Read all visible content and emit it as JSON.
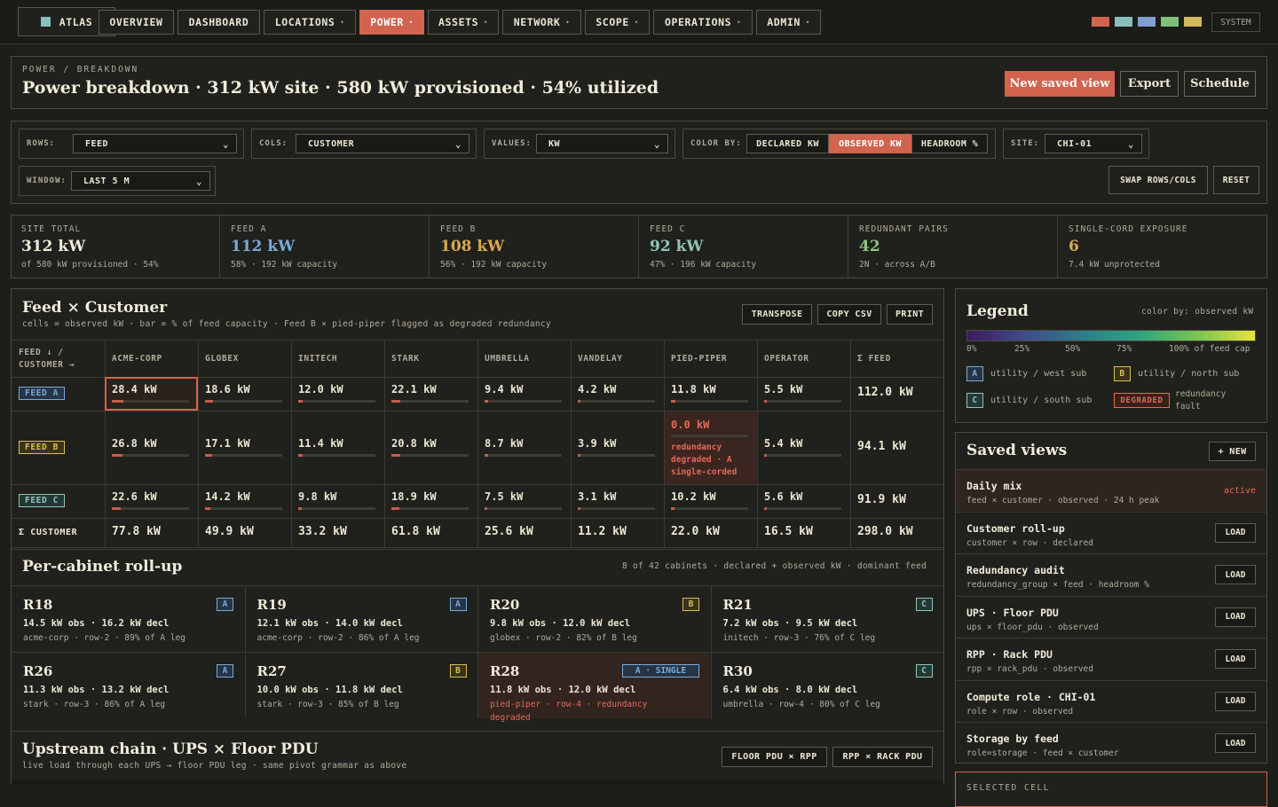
{
  "nav": {
    "logo": "ATLAS",
    "items": [
      {
        "label": "OVERVIEW",
        "caret": ""
      },
      {
        "label": "DASHBOARD",
        "caret": ""
      },
      {
        "label": "LOCATIONS",
        "caret": "▾"
      },
      {
        "label": "POWER",
        "caret": "▾"
      },
      {
        "label": "ASSETS",
        "caret": "▾"
      },
      {
        "label": "NETWORK",
        "caret": "▾"
      },
      {
        "label": "SCOPE",
        "caret": "▾"
      },
      {
        "label": "OPERATIONS",
        "caret": "▾"
      },
      {
        "label": "ADMIN",
        "caret": "▾"
      }
    ],
    "swatches": [
      "#d1634f",
      "#8bbfbd",
      "#7f9fd0",
      "#7fbf7a",
      "#d4b85c"
    ],
    "system": "SYSTEM"
  },
  "header": {
    "breadcrumb": "POWER / BREAKDOWN",
    "title": "Power breakdown · 312 kW site · 580 kW provisioned · 54% utilized",
    "buttons": {
      "new_view": "New saved view",
      "export": "Export",
      "schedule": "Schedule"
    }
  },
  "controls": {
    "rows_label": "ROWS:",
    "rows_value": "FEED",
    "cols_label": "COLS:",
    "cols_value": "CUSTOMER",
    "values_label": "VALUES:",
    "values_value": "KW",
    "color_label": "COLOR BY:",
    "color_options": [
      "DECLARED KW",
      "OBSERVED KW",
      "HEADROOM %"
    ],
    "color_selected": "OBSERVED KW",
    "site_label": "SITE:",
    "site_value": "CHI-01",
    "window_label": "WINDOW:",
    "window_value": "LAST 5 M",
    "swap": "SWAP ROWS/COLS",
    "reset": "RESET"
  },
  "kpis": [
    {
      "label": "SITE TOTAL",
      "value": "312 kW",
      "sub": "of 580 kW provisioned · 54%",
      "color": "#f1ecdd"
    },
    {
      "label": "FEED A",
      "value": "112 kW",
      "sub": "58% · 192 kW capacity",
      "color": "#7aaad8"
    },
    {
      "label": "FEED B",
      "value": "108 kW",
      "sub": "56% · 192 kW capacity",
      "color": "#d9a94f"
    },
    {
      "label": "FEED C",
      "value": "92 kW",
      "sub": "47% · 196 kW capacity",
      "color": "#8fc4b9"
    },
    {
      "label": "REDUNDANT PAIRS",
      "value": "42",
      "sub": "2N · across A/B",
      "color": "#8fc47f"
    },
    {
      "label": "SINGLE-CORD EXPOSURE",
      "value": "6",
      "sub": "7.4 kW unprotected",
      "color": "#d9a94f"
    }
  ],
  "pivot": {
    "title": "Feed × Customer",
    "subtitle": "cells = observed kW · bar = % of feed capacity · Feed B × pied-piper flagged as degraded redundancy",
    "buttons": [
      "TRANSPOSE",
      "COPY CSV",
      "PRINT"
    ],
    "corner": [
      "FEED ↓ /",
      "CUSTOMER →"
    ],
    "columns": [
      "ACME-CORP",
      "GLOBEX",
      "INITECH",
      "STARK",
      "UMBRELLA",
      "VANDELAY",
      "PIED-PIPER",
      "OPERATOR",
      "Σ FEED"
    ],
    "rows": [
      {
        "label": "FEED A",
        "cells": [
          "28.4 kW",
          "18.6 kW",
          "12.0 kW",
          "22.1 kW",
          "9.4 kW",
          "4.2 kW",
          "11.8 kW",
          "5.5 kW"
        ],
        "fill": [
          0.15,
          0.1,
          0.06,
          0.12,
          0.05,
          0.02,
          0.06,
          0.03
        ],
        "total": "112.0 kW"
      },
      {
        "label": "FEED B",
        "cells": [
          "26.8 kW",
          "17.1 kW",
          "11.4 kW",
          "20.8 kW",
          "8.7 kW",
          "3.9 kW",
          "0.0 kW",
          "5.4 kW"
        ],
        "fill": [
          0.14,
          0.09,
          0.06,
          0.11,
          0.05,
          0.02,
          0,
          0.03
        ],
        "total": "94.1 kW",
        "alert": "redundancy degraded · A single-corded"
      },
      {
        "label": "FEED C",
        "cells": [
          "22.6 kW",
          "14.2 kW",
          "9.8 kW",
          "18.9 kW",
          "7.5 kW",
          "3.1 kW",
          "10.2 kW",
          "5.6 kW"
        ],
        "fill": [
          0.12,
          0.07,
          0.05,
          0.1,
          0.04,
          0.02,
          0.05,
          0.03
        ],
        "total": "91.9 kW"
      }
    ],
    "total_label": "Σ CUSTOMER",
    "totals": [
      "77.8 kW",
      "49.9 kW",
      "33.2 kW",
      "61.8 kW",
      "25.6 kW",
      "11.2 kW",
      "22.0 kW",
      "16.5 kW",
      "298.0 kW"
    ]
  },
  "cabinets": {
    "title": "Per-cabinet roll-up",
    "meta": "8 of 42 cabinets · declared + observed kW · dominant feed",
    "items": [
      {
        "name": "R18",
        "tag": "A",
        "values": "14.5 kW obs · 16.2 kW decl",
        "meta": "acme-corp · row-2 · 89% of A leg"
      },
      {
        "name": "R19",
        "tag": "A",
        "values": "12.1 kW obs · 14.0 kW decl",
        "meta": "acme-corp · row-2 · 86% of A leg"
      },
      {
        "name": "R20",
        "tag": "B",
        "values": "9.8 kW obs · 12.0 kW decl",
        "meta": "globex · row-2 · 82% of B leg"
      },
      {
        "name": "R21",
        "tag": "C",
        "values": "7.2 kW obs · 9.5 kW decl",
        "meta": "initech · row-3 · 76% of C leg"
      },
      {
        "name": "R26",
        "tag": "A",
        "values": "11.3 kW obs · 13.2 kW decl",
        "meta": "stark · row-3 · 86% of A leg"
      },
      {
        "name": "R27",
        "tag": "B",
        "values": "10.0 kW obs · 11.8 kW decl",
        "meta": "stark · row-3 · 85% of B leg"
      },
      {
        "name": "R28",
        "tag": "A · SINGLE",
        "values": "11.8 kW obs · 12.0 kW decl",
        "meta": "pied-piper · row-4 · redundancy",
        "meta2": "degraded",
        "alert": true
      },
      {
        "name": "R30",
        "tag": "C",
        "values": "6.4 kW obs · 8.0 kW decl",
        "meta": "umbrella · row-4 · 80% of C leg"
      }
    ]
  },
  "upstream": {
    "title": "Upstream chain · UPS × Floor PDU",
    "subtitle": "live load through each UPS → floor PDU leg · same pivot grammar as above",
    "buttons": [
      "FLOOR PDU × RPP",
      "RPP × RACK PDU"
    ]
  },
  "legend": {
    "title": "Legend",
    "color_by": "color by: observed kW",
    "scale": [
      "0%",
      "25%",
      "50%",
      "75%",
      "100% of feed cap"
    ],
    "items": [
      {
        "tag": "A",
        "text": "utility / west sub"
      },
      {
        "tag": "B",
        "text": "utility / north sub"
      },
      {
        "tag": "C",
        "text": "utility / south sub"
      },
      {
        "tag": "DEGRADED",
        "text": "redundancy fault"
      }
    ]
  },
  "saved_views": {
    "title": "Saved views",
    "new": "+ NEW",
    "items": [
      {
        "name": "Daily mix",
        "desc": "feed × customer · observed · 24 h peak",
        "action": "active"
      },
      {
        "name": "Customer roll-up",
        "desc": "customer × row · declared",
        "action": "LOAD"
      },
      {
        "name": "Redundancy audit",
        "desc": "redundancy_group × feed · headroom %",
        "action": "LOAD"
      },
      {
        "name": "UPS · Floor PDU",
        "desc": "ups × floor_pdu · observed",
        "action": "LOAD"
      },
      {
        "name": "RPP · Rack PDU",
        "desc": "rpp × rack_pdu · observed",
        "action": "LOAD"
      },
      {
        "name": "Compute role · CHI-01",
        "desc": "role × row · observed",
        "action": "LOAD"
      },
      {
        "name": "Storage by feed",
        "desc": "role=storage · feed × customer",
        "action": "LOAD"
      }
    ],
    "next_section": "SELECTED CELL"
  }
}
